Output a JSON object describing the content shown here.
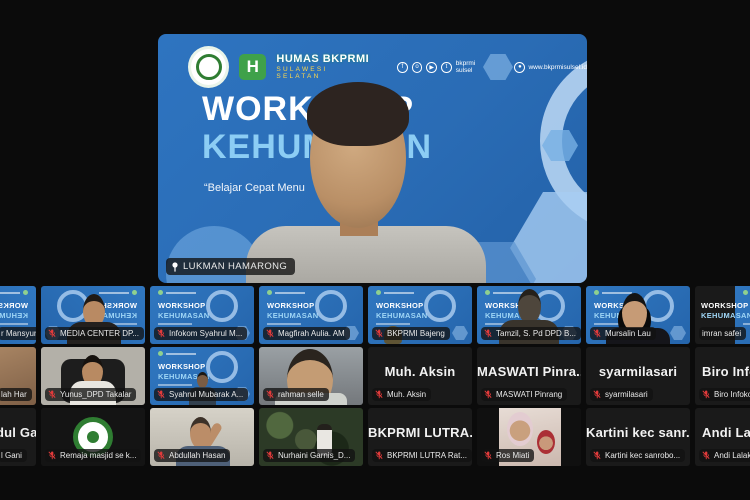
{
  "app": {
    "view": "video-conference-gallery",
    "colors": {
      "page_bg": "#0b0b0b",
      "slide_blue": "#2a6cb5",
      "title_light_blue": "#8ccdf4",
      "muted_mic_red": "#e23b3b",
      "label_bg": "#121212",
      "org_green": "#3fa14a",
      "org_yellow": "#ffd94a"
    }
  },
  "main_speaker": {
    "name_label": "LUKMAN HAMARONG",
    "pinned": true,
    "banner": {
      "org_logo": "bkprmi-emblem",
      "humas_logo_letter": "H",
      "org_name_line1": "HUMAS BKPRMI",
      "org_name_line2": "SULAWESI SELATAN",
      "social_icons": [
        "facebook",
        "instagram",
        "youtube",
        "twitter"
      ],
      "social_handle": "bkprmi sulsel",
      "website": "www.bkprmisulsel.id",
      "title_line1": "WORKSHOP",
      "title_line2": "KEHUMASAN",
      "subtitle": "“Belajar Cepat Menu"
    }
  },
  "workshop_bg": {
    "line1": "WORKSHOP",
    "line2": "KEHUMASAN"
  },
  "participants": {
    "rows": [
      {
        "tiles": [
          {
            "label": "r Mansyur, L...",
            "muted": false,
            "variant": "v-workshop",
            "mirrored": true,
            "clip": "left"
          },
          {
            "label": "MEDIA CENTER DP...",
            "muted": true,
            "variant": "v-workshop v-person-front",
            "mirrored": true
          },
          {
            "label": "Infokom Syahrul M...",
            "muted": true,
            "variant": "v-workshop"
          },
          {
            "label": "Magfirah Aulia. AM",
            "muted": true,
            "variant": "v-workshop"
          },
          {
            "label": "BKPRMI Bajeng",
            "muted": true,
            "variant": "v-workshop v-object"
          },
          {
            "label": "Tamzil, S. Pd DPD B...",
            "muted": true,
            "variant": "v-workshop v-silhouette"
          },
          {
            "label": "Mursalin Lau",
            "muted": true,
            "variant": "v-workshop v-headphones"
          },
          {
            "label": "imran safei",
            "muted": false,
            "variant": "v-darkws",
            "clip": "right"
          }
        ]
      },
      {
        "tiles": [
          {
            "label": "lah Har",
            "muted": false,
            "variant": "v-facetop",
            "clip": "left"
          },
          {
            "label": "Yunus_DPD Takalar",
            "muted": true,
            "variant": "v-chair"
          },
          {
            "label": "Syahrul Mubarak A...",
            "muted": true,
            "variant": "v-workshop v-speaker"
          },
          {
            "label": "rahman selle",
            "muted": true,
            "variant": "v-closeup"
          },
          {
            "label": "Muh. Aksin",
            "display": "Muh. Aksin",
            "muted": true,
            "variant": "v-black"
          },
          {
            "label": "MASWATI Pinrang",
            "display": "MASWATI  Pinra...",
            "muted": true,
            "variant": "v-black"
          },
          {
            "label": "syarmilasari",
            "display": "syarmilasari",
            "muted": true,
            "variant": "v-black"
          },
          {
            "label": "Biro Infokom BKP...",
            "display": "Biro Infokom",
            "muted": true,
            "variant": "v-black",
            "clip": "right"
          }
        ]
      },
      {
        "tiles": [
          {
            "label": "l Gani",
            "display": "dul Gani",
            "muted": false,
            "variant": "v-black",
            "clip": "left"
          },
          {
            "label": "Remaja masjid se k...",
            "muted": true,
            "variant": "v-greenlogo"
          },
          {
            "label": "Abdullah Hasan",
            "muted": true,
            "variant": "v-headhand"
          },
          {
            "label": "Nurhaini Garnis_D...",
            "muted": true,
            "variant": "v-outdoor"
          },
          {
            "label": "BKPRMI LUTRA Rat...",
            "display": "BKPRMI  LUTRA...",
            "muted": true,
            "variant": "v-black"
          },
          {
            "label": "Ros Miati",
            "muted": true,
            "variant": "v-hijab"
          },
          {
            "label": "Kartini kec sanrobo...",
            "display": "Kartini kec sanr...",
            "muted": true,
            "variant": "v-black"
          },
          {
            "label": "Andi Lalak_BKPR...",
            "display": "Andi Lalak_B...",
            "muted": true,
            "variant": "v-black",
            "clip": "right"
          }
        ]
      }
    ]
  }
}
